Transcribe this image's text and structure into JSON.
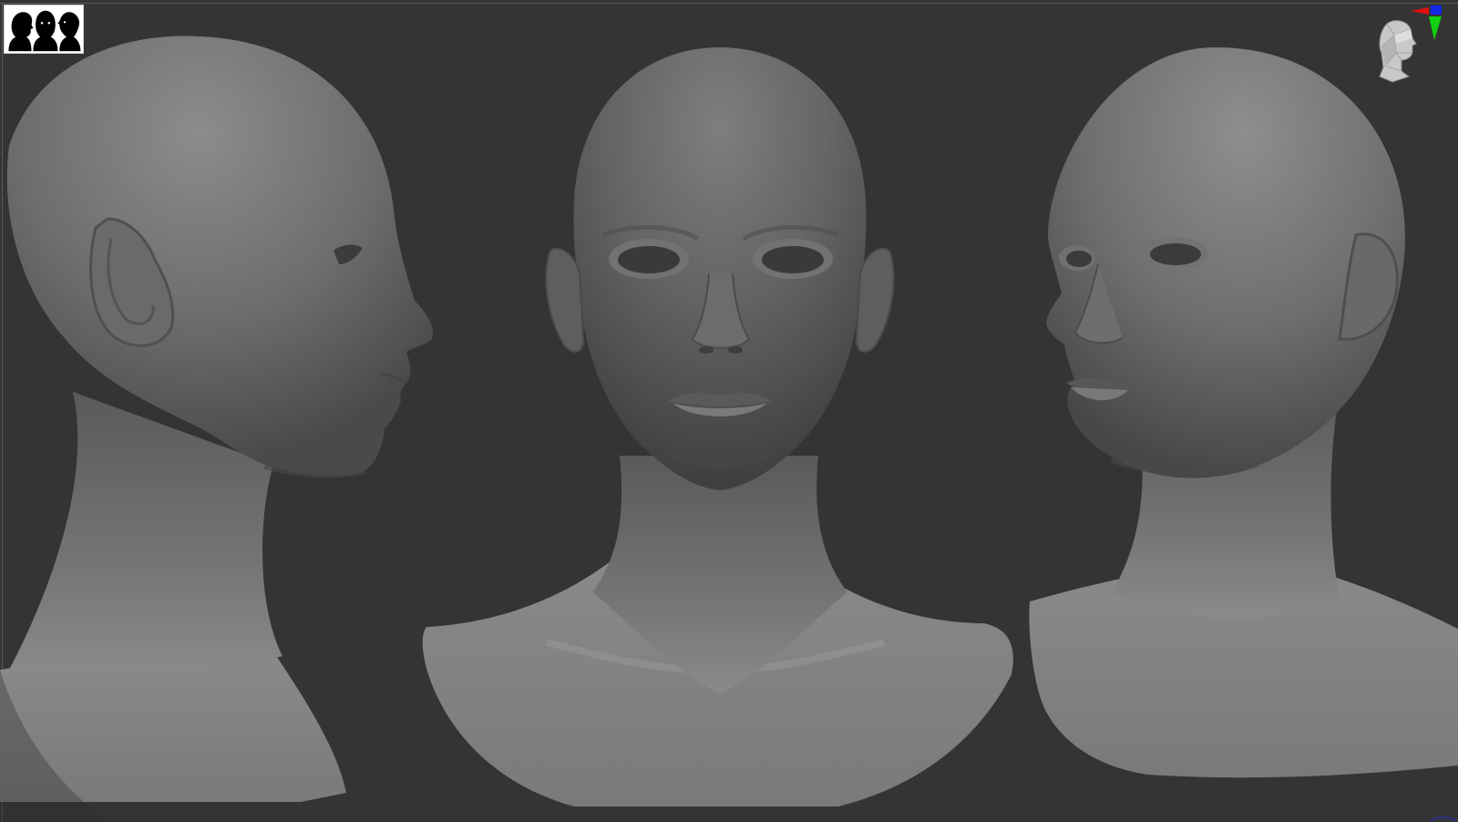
{
  "viewport": {
    "background_color": "#343434",
    "model_color": "#7c7c7c",
    "views": [
      "profile-right",
      "front",
      "three-quarter-left"
    ]
  },
  "icons": {
    "silhouette_thumbnail": "three-head-silhouettes-icon",
    "navigation_head": "navigation-head-icon",
    "axis_gizmo": "axis-gizmo-icon"
  },
  "axis_colors": {
    "x": "#e01010",
    "y": "#12d012",
    "z": "#1428e8"
  }
}
